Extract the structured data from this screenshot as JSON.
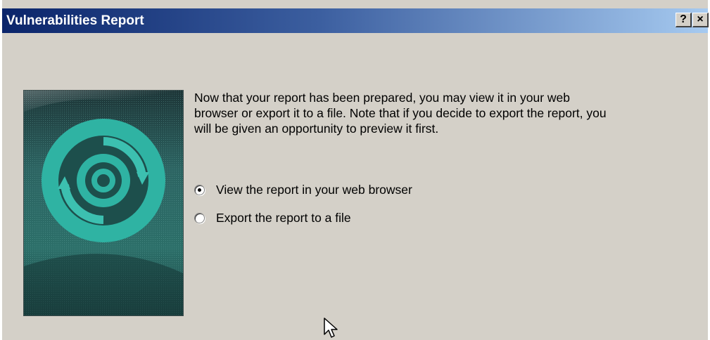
{
  "window": {
    "title": "Vulnerabilities Report",
    "help_label": "?",
    "close_label": "×"
  },
  "description": "Now that your report has been prepared, you may view it in your web browser or export it to a file.  Note that if you decide to export the report, you will be given an opportunity to preview it first.",
  "options": [
    {
      "label": "View the report in your web browser",
      "selected": true
    },
    {
      "label": "Export the report to a file",
      "selected": false
    }
  ],
  "colors": {
    "title_bar_start": "#0a246a",
    "title_bar_end": "#a6caf0",
    "dialog_bg": "#d4d0c8",
    "art_accent": "#2fb3a3"
  },
  "icons": [
    "question-mark-icon",
    "close-icon",
    "refresh-cycle-graphic",
    "mouse-pointer-icon"
  ]
}
